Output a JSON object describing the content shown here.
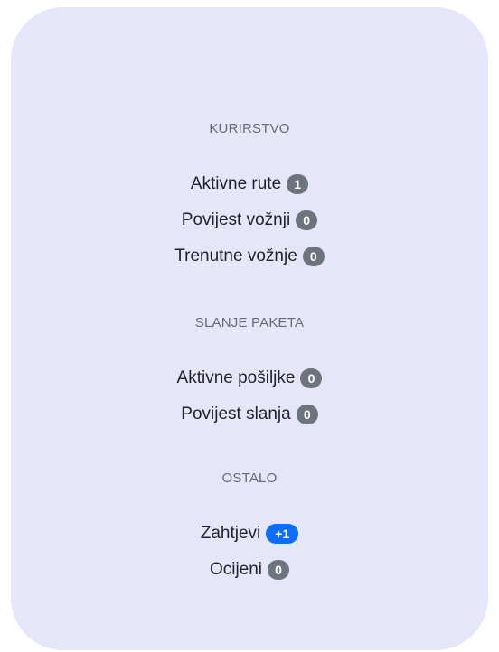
{
  "sections": [
    {
      "title": "KURIRSTVO",
      "items": [
        {
          "label": "Aktivne rute",
          "badge": "1"
        },
        {
          "label": "Povijest vožnji",
          "badge": "0"
        },
        {
          "label": "Trenutne vožnje",
          "badge": "0"
        }
      ]
    },
    {
      "title": "SLANJE PAKETA",
      "items": [
        {
          "label": "Aktivne pošiljke",
          "badge": "0"
        },
        {
          "label": "Povijest slanja",
          "badge": "0"
        }
      ]
    },
    {
      "title": "OSTALO",
      "items": [
        {
          "label": "Zahtjevi",
          "badge": "+1"
        },
        {
          "label": "Ocijeni",
          "badge": "0"
        }
      ]
    }
  ],
  "colors": {
    "panel_background": "#e6e6fa",
    "badge_secondary": "#6c757d",
    "badge_primary": "#0d6efd"
  }
}
